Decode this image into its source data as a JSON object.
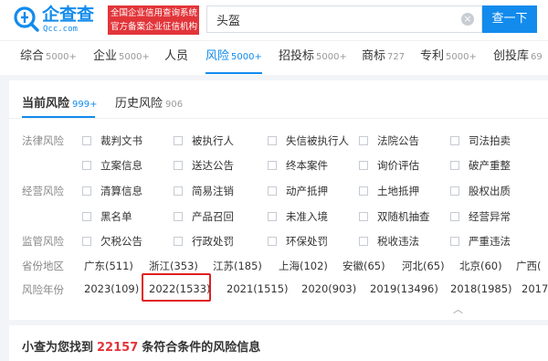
{
  "header": {
    "logo_text": "企查查",
    "logo_sub": "Qcc.com",
    "slogan_line1": "全国企业信用查询系统",
    "slogan_line2": "官方备案企业征信机构",
    "search_value": "头盔",
    "search_button": "查一下",
    "brand_color": "#128bed",
    "slogan_color": "#e2353a"
  },
  "categories": [
    {
      "label": "综合",
      "count": "5000+"
    },
    {
      "label": "企业",
      "count": "5000+"
    },
    {
      "label": "人员",
      "count": ""
    },
    {
      "label": "风险",
      "count": "5000+"
    },
    {
      "label": "招投标",
      "count": "5000+"
    },
    {
      "label": "商标",
      "count": "727"
    },
    {
      "label": "专利",
      "count": "5000+"
    },
    {
      "label": "创投库",
      "count": "69"
    }
  ],
  "active_category": "风险",
  "sub_tabs": [
    {
      "label": "当前风险",
      "count": "999+"
    },
    {
      "label": "历史风险",
      "count": "906"
    }
  ],
  "filters": {
    "legal_label": "法律风险",
    "legal_row1": [
      "裁判文书",
      "被执行人",
      "失信被执行人",
      "法院公告",
      "司法拍卖"
    ],
    "legal_row2": [
      "立案信息",
      "送达公告",
      "终本案件",
      "询价评估",
      "破产重整"
    ],
    "business_label": "经营风险",
    "business_row1": [
      "清算信息",
      "简易注销",
      "动产抵押",
      "土地抵押",
      "股权出质"
    ],
    "business_row2": [
      "黑名单",
      "产品召回",
      "未准入境",
      "双随机抽查",
      "经营异常"
    ],
    "regulatory_label": "监管风险",
    "regulatory_row": [
      "欠税公告",
      "行政处罚",
      "环保处罚",
      "税收违法",
      "严重违法"
    ],
    "province_label": "省份地区",
    "provinces": [
      "广东(511)",
      "浙江(353)",
      "江苏(185)",
      "上海(102)",
      "安徽(65)",
      "河北(65)",
      "北京(60)",
      "广西("
    ],
    "year_label": "风险年份",
    "years": [
      "2023(109)",
      "2022(1533)",
      "2021(1515)",
      "2020(903)",
      "2019(13496)",
      "2018(1985)",
      "2017"
    ]
  },
  "result": {
    "prefix": "小查为您找到",
    "count": "22157",
    "suffix": "条符合条件的风险信息"
  }
}
